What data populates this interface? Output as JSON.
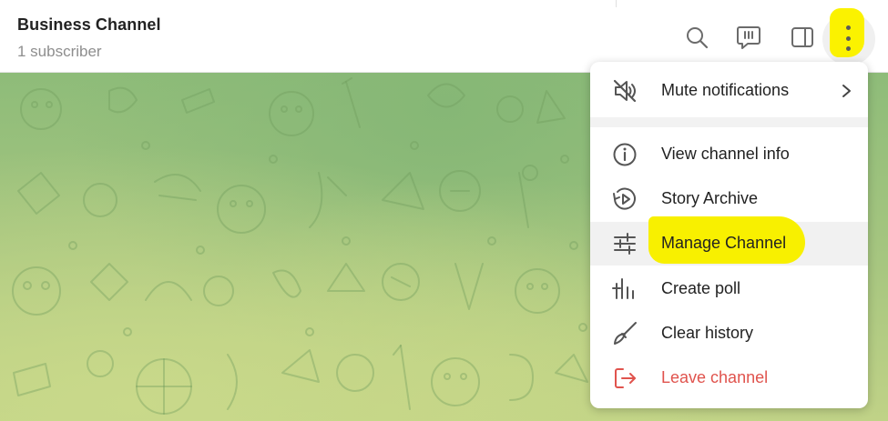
{
  "header": {
    "channel_name": "Business Channel",
    "subscriber_count": "1 subscriber",
    "icons": [
      "search-icon",
      "comments-icon",
      "sidebar-icon",
      "more-vertical-icon"
    ]
  },
  "menu": {
    "items": [
      {
        "label": "Mute notifications",
        "icon": "mute-notifications-icon",
        "has_submenu": true
      },
      {
        "label": "View channel info",
        "icon": "info-icon"
      },
      {
        "label": "Story Archive",
        "icon": "story-archive-icon"
      },
      {
        "label": "Manage Channel",
        "icon": "sliders-icon",
        "highlighted": true
      },
      {
        "label": "Create poll",
        "icon": "poll-icon"
      },
      {
        "label": "Clear history",
        "icon": "broom-icon"
      },
      {
        "label": "Leave channel",
        "icon": "leave-icon",
        "danger": true
      }
    ]
  },
  "colors": {
    "accent_highlight": "#f8f000",
    "danger": "#e0534d",
    "chat_bg_top": "#8ebc79",
    "chat_bg_bottom": "#c0d287"
  }
}
